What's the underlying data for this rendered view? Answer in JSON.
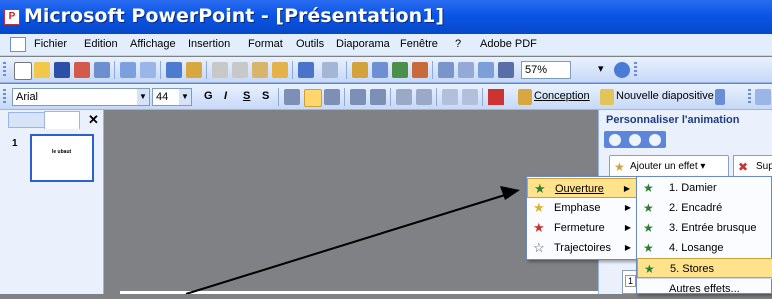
{
  "window": {
    "title": "Microsoft PowerPoint - [Présentation1]"
  },
  "menubar": {
    "items": [
      "Fichier",
      "Edition",
      "Affichage",
      "Insertion",
      "Format",
      "Outils",
      "Diaporama",
      "Fenêtre",
      "?",
      "Adobe PDF"
    ]
  },
  "toolbar1": {
    "zoom": "57%"
  },
  "toolbar2": {
    "font": "Arial",
    "size": "44",
    "bold": "G",
    "italic": "I",
    "underline": "S",
    "shadow": "S",
    "design": "Conception",
    "new_slide": "Nouvelle diapositive"
  },
  "slides_panel": {
    "slide_number": "1",
    "thumb_text": "Ie ubaut"
  },
  "taskpane": {
    "title": "Personnaliser l'animation",
    "add_effect": "Ajouter un effet ▾",
    "remove": "Supp",
    "list_value": "1"
  },
  "effect_menu": {
    "items": [
      {
        "label": "Ouverture",
        "icon": "green-star-icon"
      },
      {
        "label": "Emphase",
        "icon": "yellow-star-icon"
      },
      {
        "label": "Fermeture",
        "icon": "red-star-icon"
      },
      {
        "label": "Trajectoires",
        "icon": "outline-star-icon"
      }
    ]
  },
  "entrance_menu": {
    "items": [
      {
        "label": "1. Damier"
      },
      {
        "label": "2. Encadré"
      },
      {
        "label": "3. Entrée brusque"
      },
      {
        "label": "4. Losange"
      },
      {
        "label": "5. Stores"
      },
      {
        "label": "Autres effets..."
      }
    ]
  },
  "colors": {
    "titlebar": "#0a55e6",
    "highlight": "#ffe38c",
    "workspace": "#7f8184"
  }
}
